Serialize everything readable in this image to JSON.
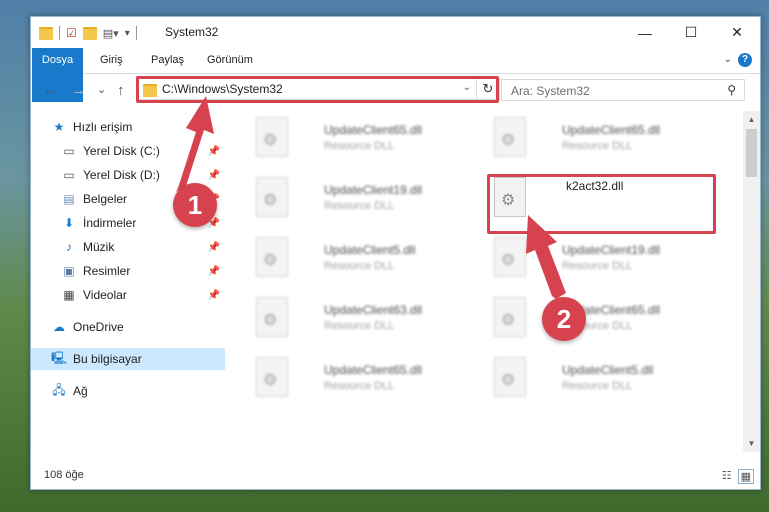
{
  "window": {
    "title": "System32",
    "controls": {
      "minimize": "—",
      "maximize": "☐",
      "close": "✕"
    }
  },
  "ribbon": {
    "tabs": [
      "Dosya",
      "Giriş",
      "Paylaş",
      "Görünüm"
    ],
    "help": "?"
  },
  "nav": {
    "back": "←",
    "forward": "→",
    "recent": "⌄",
    "up": "↑",
    "address": "C:\\Windows\\System32",
    "refresh": "↻",
    "search_placeholder": "Ara: System32"
  },
  "sidebar": {
    "items": [
      {
        "label": "Hızlı erişim",
        "icon": "star-icon"
      },
      {
        "label": "Yerel Disk (C:)",
        "icon": "drive-icon"
      },
      {
        "label": "Yerel Disk (D:)",
        "icon": "drive-icon"
      },
      {
        "label": "Belgeler",
        "icon": "documents-icon"
      },
      {
        "label": "İndirmeler",
        "icon": "download-icon"
      },
      {
        "label": "Müzik",
        "icon": "music-icon"
      },
      {
        "label": "Resimler",
        "icon": "pictures-icon"
      },
      {
        "label": "Videolar",
        "icon": "video-icon"
      },
      {
        "label": "OneDrive",
        "icon": "cloud-icon"
      },
      {
        "label": "Bu bilgisayar",
        "icon": "computer-icon"
      },
      {
        "label": "Ağ",
        "icon": "network-icon"
      }
    ]
  },
  "files": [
    {
      "name": "UpdateClient65.dll",
      "desc": "Resource DLL"
    },
    {
      "name": "UpdateClient65.dll",
      "desc": "Resource DLL"
    },
    {
      "name": "UpdateClient19.dll",
      "desc": "Resource DLL"
    },
    {
      "name": "k2act32.dll",
      "desc": ""
    },
    {
      "name": "UpdateClient5.dll",
      "desc": "Resource DLL"
    },
    {
      "name": "UpdateClient19.dll",
      "desc": "Resource DLL"
    },
    {
      "name": "UpdateClient63.dll",
      "desc": "Resource DLL"
    },
    {
      "name": "UpdateClient65.dll",
      "desc": "Resource DLL"
    },
    {
      "name": "UpdateClient65.dll",
      "desc": "Resource DLL"
    },
    {
      "name": "UpdateClient5.dll",
      "desc": "Resource DLL"
    }
  ],
  "status": {
    "count": "108 öğe"
  },
  "callouts": {
    "step1": "1",
    "step2": "2"
  },
  "colors": {
    "accent": "#1979ca",
    "highlight": "#d6424e"
  }
}
